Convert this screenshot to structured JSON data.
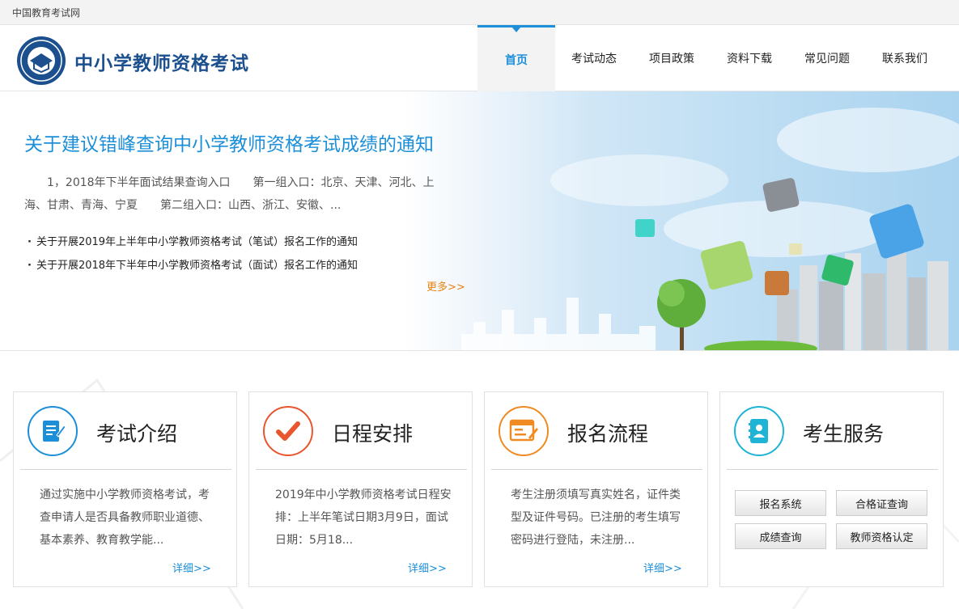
{
  "topbar": {
    "site_name": "中国教育考试网"
  },
  "header": {
    "title": "中小学教师资格考试"
  },
  "nav": [
    {
      "label": "首页",
      "active": true
    },
    {
      "label": "考试动态"
    },
    {
      "label": "项目政策"
    },
    {
      "label": "资料下载"
    },
    {
      "label": "常见问题"
    },
    {
      "label": "联系我们"
    }
  ],
  "banner": {
    "headline": "关于建议错峰查询中小学教师资格考试成绩的通知",
    "summary_line1": "1，2018年下半年面试结果查询入口　　第一组入口：北京、天津、河北、上",
    "summary_line2": "海、甘肃、青海、宁夏　　第二组入口：山西、浙江、安徽、...",
    "news": [
      "关于开展2019年上半年中小学教师资格考试（笔试）报名工作的通知",
      "关于开展2018年下半年中小学教师资格考试（面试）报名工作的通知"
    ],
    "more": "更多>>"
  },
  "cards": [
    {
      "title": "考试介绍",
      "icon": "document-edit-icon",
      "color": "#1d8fd8",
      "desc": "通过实施中小学教师资格考试，考查申请人是否具备教师职业道德、基本素养、教育教学能...",
      "detail": "详细>>"
    },
    {
      "title": "日程安排",
      "icon": "checkmark-icon",
      "color": "#e8552e",
      "desc": "2019年中小学教师资格考试日程安排：上半年笔试日期3月9日，面试日期：5月18...",
      "detail": "详细>>"
    },
    {
      "title": "报名流程",
      "icon": "registration-form-icon",
      "color": "#f08a22",
      "desc": "考生注册须填写真实姓名，证件类型及证件号码。已注册的考生填写密码进行登陆，未注册...",
      "detail": "详细>>"
    },
    {
      "title": "考生服务",
      "icon": "contact-book-icon",
      "color": "#1fb4d6",
      "buttons": [
        "报名系统",
        "合格证查询",
        "成绩查询",
        "教师资格认定"
      ]
    }
  ]
}
